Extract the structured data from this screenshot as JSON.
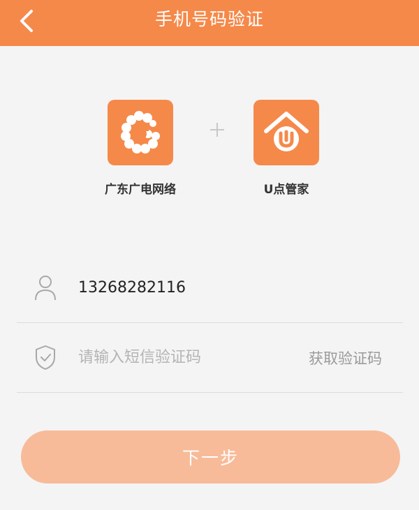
{
  "header": {
    "title": "手机号码验证",
    "back_icon": "chevron-left-icon"
  },
  "apps": {
    "left": {
      "name": "广东广电网络",
      "icon": "g-logo-icon"
    },
    "right": {
      "name": "U点管家",
      "icon": "house-u-logo-icon"
    },
    "connector_icon": "plus-icon"
  },
  "form": {
    "phone": {
      "icon": "user-icon",
      "value": "13268282116"
    },
    "code": {
      "icon": "shield-check-icon",
      "placeholder": "请输入短信验证码",
      "value": "",
      "get_code_label": "获取验证码"
    }
  },
  "next_button": {
    "label": "下一步"
  },
  "colors": {
    "accent": "#f5894a",
    "button_disabled": "#f8bb99",
    "background": "#f4f4f4"
  }
}
